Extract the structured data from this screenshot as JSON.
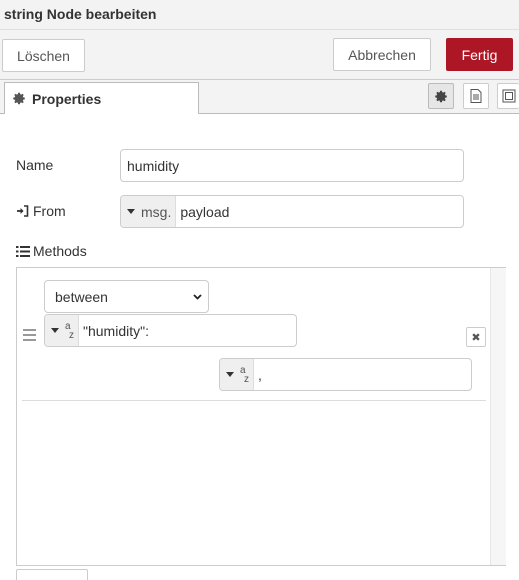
{
  "window": {
    "title": "string Node bearbeiten"
  },
  "buttons": {
    "delete": "Löschen",
    "cancel": "Abbrechen",
    "done": "Fertig"
  },
  "tabs": {
    "properties": "Properties",
    "icons": [
      "gear-icon",
      "description-icon",
      "appearance-icon"
    ]
  },
  "form": {
    "name_label": "Name",
    "name_value": "humidity",
    "from_label": "From",
    "from_type": "msg.",
    "from_value": "payload",
    "methods_label": "Methods"
  },
  "methods": [
    {
      "method": "between",
      "param1_type": "az",
      "param1_value": "\"humidity\":",
      "param2_type": "az",
      "param2_value": ","
    }
  ],
  "colors": {
    "accent": "#ad1625"
  }
}
